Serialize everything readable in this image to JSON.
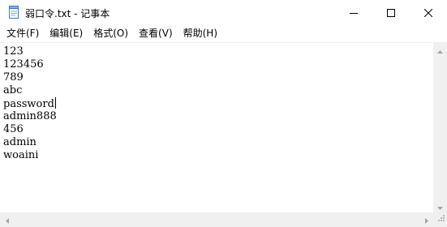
{
  "window": {
    "title": "弱口令.txt - 记事本"
  },
  "menu": {
    "items": [
      {
        "label": "文件(F)"
      },
      {
        "label": "编辑(E)"
      },
      {
        "label": "格式(O)"
      },
      {
        "label": "查看(V)"
      },
      {
        "label": "帮助(H)"
      }
    ]
  },
  "editor": {
    "lines": [
      "123",
      "123456",
      "789",
      "abc",
      "password",
      "admin888",
      "456",
      "admin",
      "woaini"
    ],
    "caret_line": 5
  },
  "icons": {
    "app": "notepad-icon",
    "minimize": "minimize-icon",
    "maximize": "maximize-icon",
    "close": "close-icon"
  }
}
